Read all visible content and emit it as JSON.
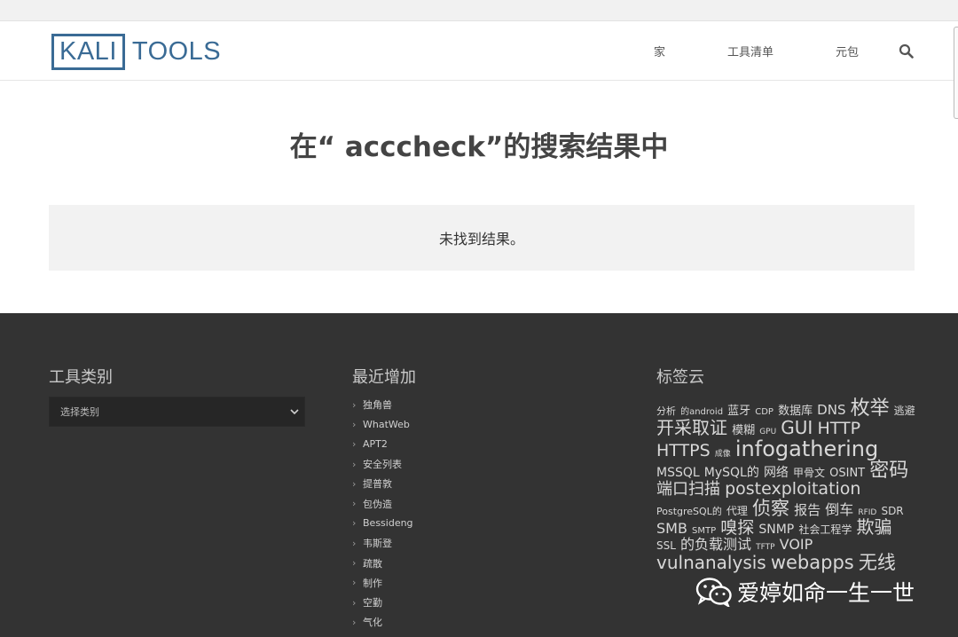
{
  "header": {
    "logo_left": "KALI",
    "logo_right": "TOOLS",
    "nav": [
      {
        "label": "家"
      },
      {
        "label": "工具清单"
      },
      {
        "label": "元包"
      }
    ]
  },
  "main": {
    "title": "在“ acccheck”的搜索结果中",
    "no_results": "未找到结果。"
  },
  "footer": {
    "categories_heading": "工具类别",
    "select_placeholder": "选择类别",
    "recent_heading": "最近增加",
    "recent_items": [
      "独角兽",
      "WhatWeb",
      "APT2",
      "安全列表",
      "提普敦",
      "包伪造",
      "Bessideng",
      "韦斯登",
      "疏散",
      "制作",
      "空勤",
      "气化"
    ],
    "tags_heading": "标签云",
    "tags": [
      {
        "text": "分析",
        "size": 11
      },
      {
        "text": "的android",
        "size": 10
      },
      {
        "text": "蓝牙",
        "size": 13
      },
      {
        "text": "CDP",
        "size": 10
      },
      {
        "text": "数据库",
        "size": 13
      },
      {
        "text": "DNS",
        "size": 15
      },
      {
        "text": "枚举",
        "size": 22
      },
      {
        "text": "逃避",
        "size": 12
      },
      {
        "text": "开采取证",
        "size": 20
      },
      {
        "text": "模糊",
        "size": 13
      },
      {
        "text": "GPU",
        "size": 9
      },
      {
        "text": "GUI",
        "size": 20
      },
      {
        "text": "HTTP",
        "size": 19
      },
      {
        "text": "HTTPS",
        "size": 19
      },
      {
        "text": "成像",
        "size": 9
      },
      {
        "text": "infogathering",
        "size": 24
      },
      {
        "text": "MSSQL",
        "size": 14
      },
      {
        "text": "MySQL的",
        "size": 14
      },
      {
        "text": "网络",
        "size": 14
      },
      {
        "text": "甲骨文",
        "size": 12
      },
      {
        "text": "OSINT",
        "size": 13
      },
      {
        "text": "密码",
        "size": 22
      },
      {
        "text": "端口扫描",
        "size": 18
      },
      {
        "text": "postexploitation",
        "size": 19
      },
      {
        "text": "PostgreSQL的",
        "size": 11
      },
      {
        "text": "代理",
        "size": 12
      },
      {
        "text": "侦察",
        "size": 21
      },
      {
        "text": "报告",
        "size": 15
      },
      {
        "text": "倒车",
        "size": 16
      },
      {
        "text": "RFID",
        "size": 9
      },
      {
        "text": "SDR",
        "size": 12
      },
      {
        "text": "SMB",
        "size": 16
      },
      {
        "text": "SMTP",
        "size": 10
      },
      {
        "text": "嗅探",
        "size": 19
      },
      {
        "text": "SNMP",
        "size": 14
      },
      {
        "text": "社会工程学",
        "size": 12
      },
      {
        "text": "欺骗",
        "size": 20
      },
      {
        "text": "SSL",
        "size": 12
      },
      {
        "text": "的负载测试",
        "size": 16
      },
      {
        "text": "TFTP",
        "size": 9
      },
      {
        "text": "VOIP",
        "size": 16
      },
      {
        "text": "vulnanalysis",
        "size": 20
      },
      {
        "text": "webapps",
        "size": 21
      },
      {
        "text": "无线",
        "size": 21
      }
    ]
  },
  "watermark": {
    "text": "爱婷如命一生一世",
    "icon": "wechat-icon"
  },
  "colors": {
    "brand": "#3a6b95",
    "footer_bg": "#333333",
    "noresult_bg": "#f2f2f2"
  }
}
